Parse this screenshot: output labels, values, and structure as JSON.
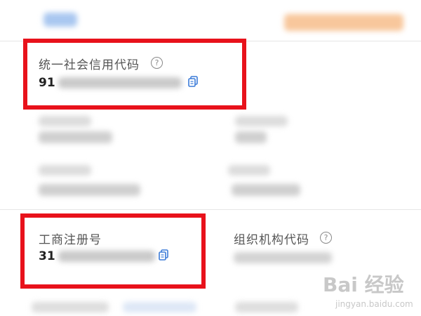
{
  "fields": {
    "credit_code": {
      "label": "统一社会信用代码",
      "help_icon": "?",
      "value_prefix": "91"
    },
    "business_reg": {
      "label": "工商注册号",
      "value_prefix": "31"
    },
    "org_code": {
      "label": "组织机构代码",
      "help_icon": "?"
    }
  },
  "watermark": {
    "logo": "Bai 经验",
    "site": "jingyan.baidu.com"
  },
  "colors": {
    "highlight_red": "#e8121b",
    "copy_blue": "#3b7bd8",
    "accent_orange": "#f6a25a",
    "link_blue": "#4a86e8"
  }
}
